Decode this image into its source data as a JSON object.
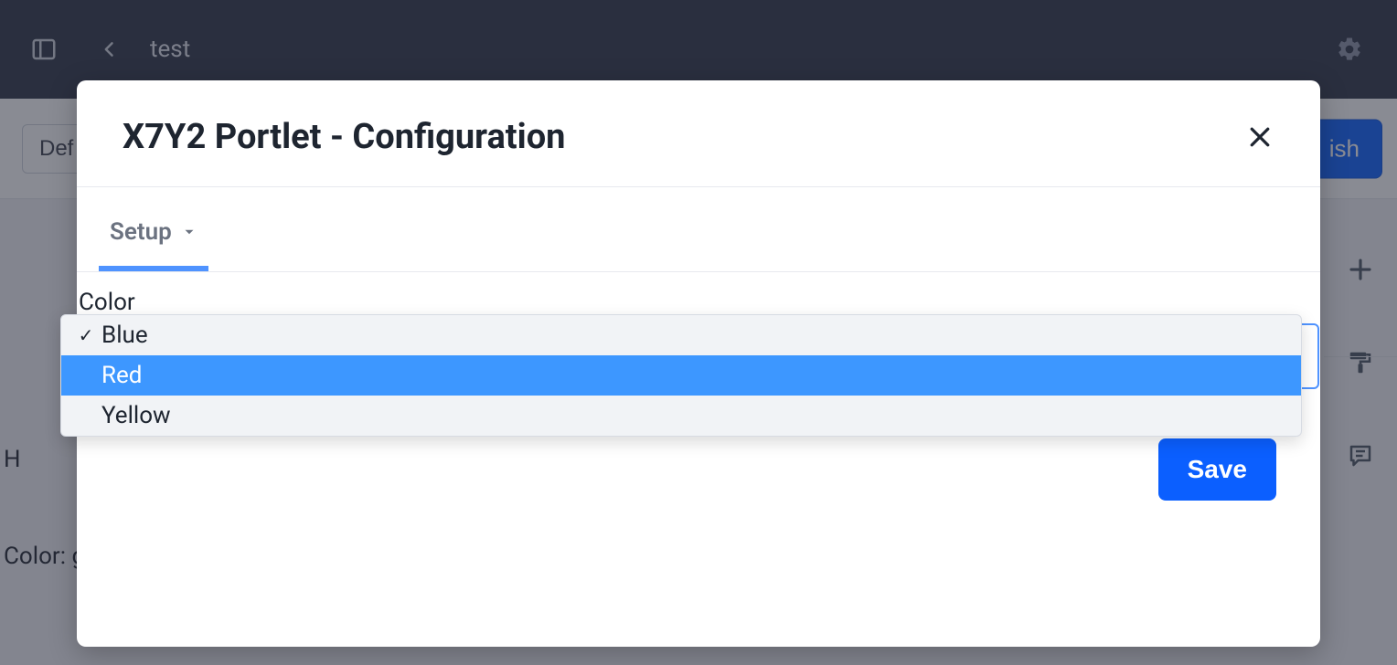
{
  "topbar": {
    "title": "test"
  },
  "subbar": {
    "default_button_label": "Def",
    "publish_label": "ish"
  },
  "page": {
    "line1_prefix": "H",
    "line2": "Color: g"
  },
  "modal": {
    "title": "X7Y2 Portlet - Configuration",
    "tab_label": "Setup",
    "field_label": "Color",
    "save_label": "Save",
    "options": [
      {
        "label": "Blue",
        "selected": true,
        "highlighted": false
      },
      {
        "label": "Red",
        "selected": false,
        "highlighted": true
      },
      {
        "label": "Yellow",
        "selected": false,
        "highlighted": false
      }
    ]
  }
}
